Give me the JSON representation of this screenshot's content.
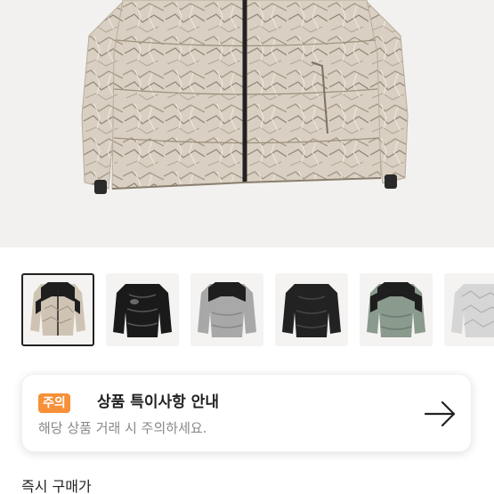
{
  "product": {
    "main_image": "beige-crumpled-pattern-puffer-jacket"
  },
  "thumbnails": [
    {
      "name": "beige-camo-puffer",
      "selected": true
    },
    {
      "name": "black-glossy-puffer",
      "selected": false
    },
    {
      "name": "grey-black-puffer",
      "selected": false
    },
    {
      "name": "black-matte-puffer",
      "selected": false
    },
    {
      "name": "sage-black-puffer",
      "selected": false
    },
    {
      "name": "silver-camo-puffer",
      "selected": false
    }
  ],
  "notice": {
    "badge": "주의",
    "title": "상품 특이사항 안내",
    "description": "해당 상품 거래 시 주의하세요.",
    "arrow_icon": "arrow-right-icon",
    "badge_color": "#f79038"
  },
  "section": {
    "title": "즉시 구매가"
  }
}
